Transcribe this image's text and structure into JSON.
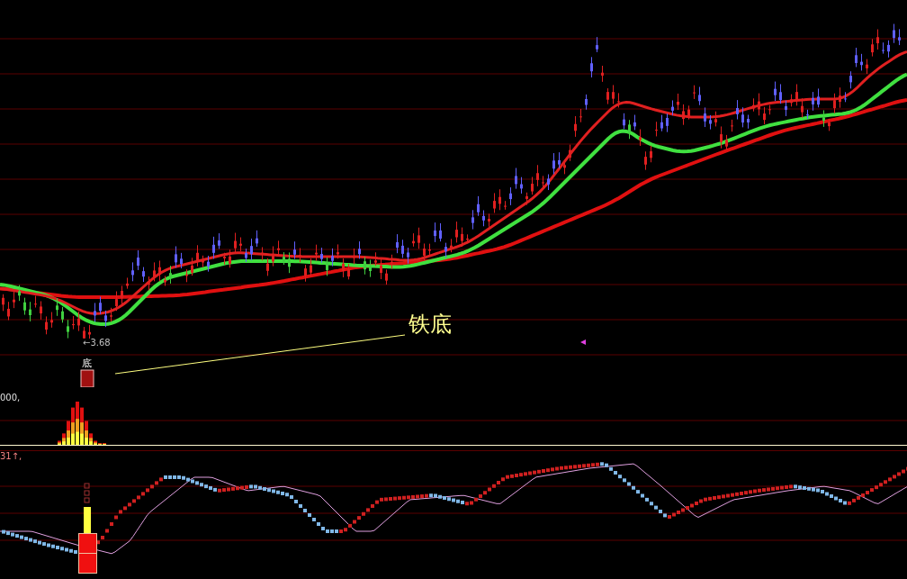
{
  "price_panel": {
    "low_label": "←3.68",
    "signal_label": "底",
    "annotation": "铁底"
  },
  "volume_panel": {
    "label": "000,"
  },
  "indicator_panel": {
    "label": "31↑,"
  }
}
